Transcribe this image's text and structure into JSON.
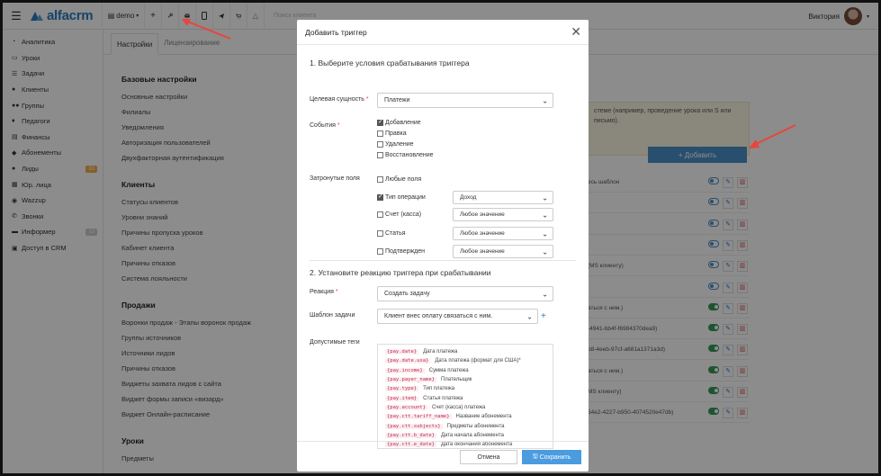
{
  "topbar": {
    "logo_text": "alfacrm",
    "demo_label": "demo",
    "search_placeholder": "Поиск клиента",
    "user_name": "Виктория"
  },
  "sidebar": {
    "items": [
      {
        "label": "Аналитика",
        "icon": "gauge-icon"
      },
      {
        "label": "Уроки",
        "icon": "calendar-icon"
      },
      {
        "label": "Задачи",
        "icon": "tasks-icon"
      },
      {
        "label": "Клиенты",
        "icon": "user-icon"
      },
      {
        "label": "Группы",
        "icon": "group-icon"
      },
      {
        "label": "Педагоги",
        "icon": "teacher-icon"
      },
      {
        "label": "Финансы",
        "icon": "money-icon"
      },
      {
        "label": "Абонементы",
        "icon": "tag-icon"
      },
      {
        "label": "Лиды",
        "icon": "lead-icon",
        "badge": "33"
      },
      {
        "label": "Юр. лица",
        "icon": "building-icon"
      },
      {
        "label": "Wazzup",
        "icon": "chat-icon"
      },
      {
        "label": "Звонки",
        "icon": "phone-icon"
      },
      {
        "label": "Информер",
        "icon": "informer-icon",
        "badge": "13"
      },
      {
        "label": "Доступ в CRM",
        "icon": "lock-icon"
      }
    ]
  },
  "tabs": [
    {
      "label": "Настройки"
    },
    {
      "label": "Лицензирование"
    }
  ],
  "settings": {
    "groups": [
      {
        "title": "Базовые настройки",
        "items": [
          "Основные настройки",
          "Филиалы",
          "Уведомления",
          "Авторизация пользователей",
          "Двухфакторная аутентификация"
        ]
      },
      {
        "title": "Клиенты",
        "items": [
          "Статусы клиентов",
          "Уровни знаний",
          "Причины пропуска уроков",
          "Кабинет клиента",
          "Причины отказов",
          "Система лояльности"
        ]
      },
      {
        "title": "Продажи",
        "items": [
          "Воронки продаж - Этапы воронок продаж",
          "Группы источников",
          "Источники лидов",
          "Причины отказов",
          "Виджеты захвата лидов с сайта",
          "Виджет формы записи «визард»",
          "Виджет Онлайн-расписание"
        ]
      },
      {
        "title": "Уроки",
        "items": [
          "Предметы"
        ]
      }
    ]
  },
  "right_panel": {
    "notice": "стеме (например, проведение урока или S или письмо).",
    "add_button": "+ Добавить",
    "rows": [
      {
        "text": "есь шаблон",
        "toggle": "off"
      },
      {
        "text": "",
        "toggle": "off"
      },
      {
        "text": "",
        "toggle": "off"
      },
      {
        "text": "",
        "toggle": "off"
      },
      {
        "text": "(МS клиенту)",
        "toggle": "off"
      },
      {
        "text": "",
        "toggle": "off"
      },
      {
        "text": "аться с ним.)",
        "toggle": "on"
      },
      {
        "text": "-4941-bb4f-f6984370dea9)",
        "toggle": "on"
      },
      {
        "text": "b8-4eeb-97cf-a681a1371a3d)",
        "toggle": "on"
      },
      {
        "text": "аться с ним.)",
        "toggle": "on"
      },
      {
        "text": "MS клиенту)",
        "toggle": "on"
      },
      {
        "text": "54e2-4227-b950-4074520e47db)",
        "toggle": "on"
      }
    ]
  },
  "modal": {
    "title": "Добавить триггер",
    "section1": "1. Выберите условия срабатывания триггера",
    "target_label": "Целевая сущность",
    "target_value": "Платежи",
    "events_label": "События",
    "events": [
      {
        "label": "Добавление",
        "checked": true
      },
      {
        "label": "Правка",
        "checked": false
      },
      {
        "label": "Удаление",
        "checked": false
      },
      {
        "label": "Восстановление",
        "checked": false
      }
    ],
    "fields_label": "Затронутые поля",
    "fields": [
      {
        "label": "Любые поля",
        "checked": false
      },
      {
        "label": "Тип операции",
        "checked": true,
        "value": "Доход"
      },
      {
        "label": "Счет (касса)",
        "checked": false,
        "value": "Любое значение"
      },
      {
        "label": "Статья",
        "checked": false,
        "value": "Любое значение"
      },
      {
        "label": "Подтвержден",
        "checked": false,
        "value": "Любое значение"
      }
    ],
    "section2": "2. Установите реакцию триггера при срабатывании",
    "reaction_label": "Реакция",
    "reaction_value": "Создать задачу",
    "template_label": "Шаблон задачи",
    "template_value": "Клиент внес оплату связаться с ним.",
    "tags_label": "Допустимые теги",
    "tags": [
      {
        "code": "{pay.date}",
        "desc": "Дата платежа"
      },
      {
        "code": "{pay.date.usa}",
        "desc": "Дата платежа (формат для США)*"
      },
      {
        "code": "{pay.income}",
        "desc": "Сумма платежа"
      },
      {
        "code": "{pay.payer_name}",
        "desc": "Плательщик"
      },
      {
        "code": "{pay.type}",
        "desc": "Тип платежа"
      },
      {
        "code": "{pay.item}",
        "desc": "Статья платежа"
      },
      {
        "code": "{pay.account}",
        "desc": "Счет (касса) платежа"
      },
      {
        "code": "{pay.ctt.tariff_name}",
        "desc": "Название абонемента"
      },
      {
        "code": "{pay.ctt.subjects}",
        "desc": "Предметы абонемента"
      },
      {
        "code": "{pay.ctt.b_date}",
        "desc": "Дата начала абонемента"
      },
      {
        "code": "{pay.ctt.e_date}",
        "desc": "Дата окончания абонемента"
      }
    ],
    "cancel_label": "Отмена",
    "save_label": "Сохранить"
  }
}
